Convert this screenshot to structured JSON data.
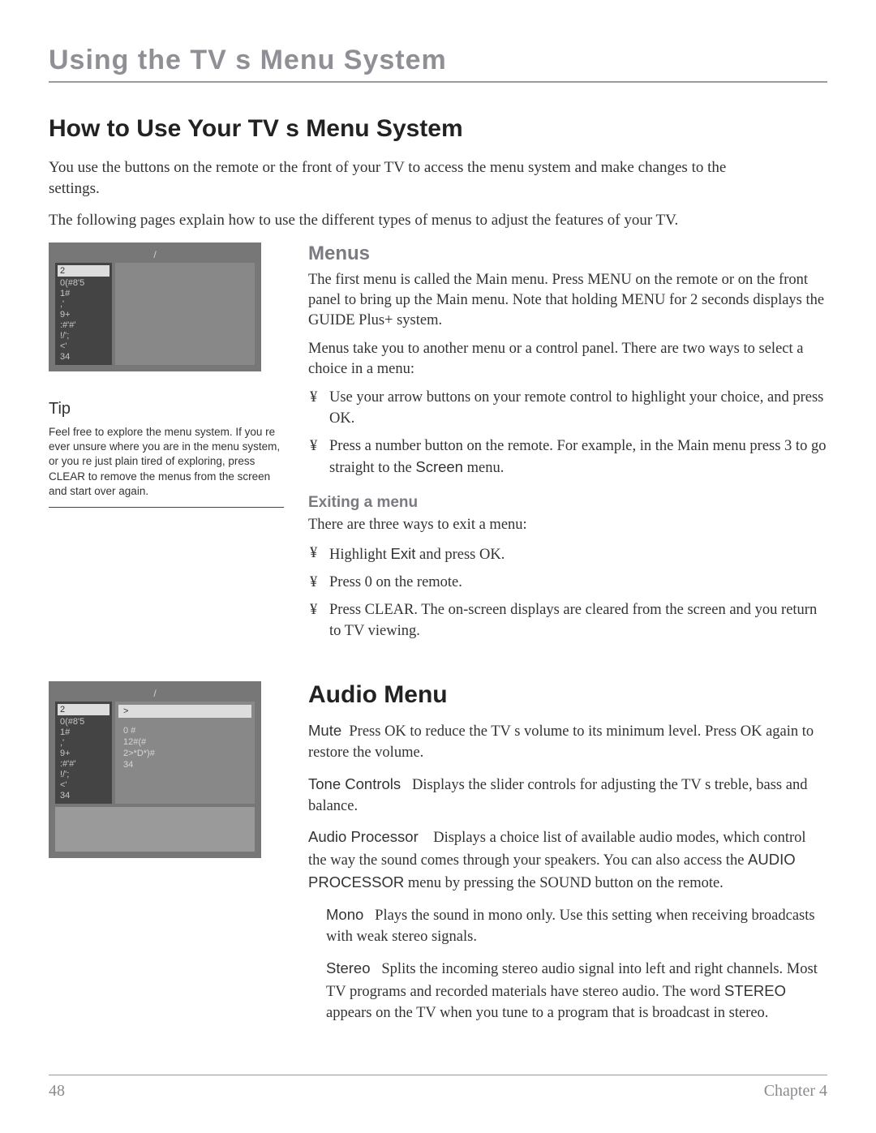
{
  "header": {
    "chapter_title": "Using the TV s Menu System"
  },
  "section1": {
    "title": "How to Use Your TV s Menu System",
    "intro1": "You use the buttons on the remote or the front of your TV to access the menu system and make changes to the settings.",
    "intro2": "The following pages explain how to use the different types of menus to adjust the features of your TV."
  },
  "main_menu_shot": {
    "top": "/",
    "items": [
      "2",
      "0(#8'5",
      "1#",
      ",'",
      "9+",
      ":#'#'",
      "!/';",
      "<'",
      "34"
    ]
  },
  "tip": {
    "heading": "Tip",
    "body": "Feel free to explore the menu system. If you   re ever unsure where you are in the menu system, or you    re just plain tired of exploring, press CLEAR to remove the menus from the screen and start over again."
  },
  "menus": {
    "heading": "Menus",
    "p1": "The first menu is called the Main menu. Press MENU on the remote or on the front panel to bring up the Main menu. Note that holding MENU for 2 seconds displays the GUIDE Plus+ system.",
    "p2": "Menus take you to another menu or a control panel. There are two ways to select a choice in a menu:",
    "bullets": [
      "Use your arrow buttons on your remote control to highlight your choice, and press OK.",
      "Press a number button on the remote. For example, in the Main menu press 3 to go straight to the Screen menu."
    ],
    "exit_heading": "Exiting a menu",
    "exit_lead": "There are three ways to exit a menu:",
    "exit_bullets": [
      "Highlight Exit and press OK.",
      "Press 0 on the remote.",
      "Press CLEAR. The on-screen displays are cleared from the screen and you return to TV viewing."
    ]
  },
  "audio_menu_shot": {
    "top": "/",
    "tabs": [
      "2",
      "0(#8'5",
      "1#",
      ",'",
      "9+",
      ":#'#'",
      "!/';",
      "<'",
      "34"
    ],
    "highlight": ">",
    "items": [
      "0  #",
      "12#(#",
      "2>*D*)#",
      "34"
    ]
  },
  "audio": {
    "title": "Audio Menu",
    "mute_term": "Mute",
    "mute": "Press OK to reduce the TV s volume to its minimum level. Press OK again to restore the volume.",
    "tone_term": "Tone Controls",
    "tone": "Displays the slider controls for adjusting the TV s treble, bass and balance.",
    "proc_term": "Audio Processor",
    "proc": "Displays a choice list of available audio modes, which control the way the sound comes through your speakers. You can also access the AUDIO PROCESSOR menu by pressing the SOUND button on the remote.",
    "mono_term": "Mono",
    "mono": "Plays the sound in mono only. Use this setting when receiving broadcasts with weak stereo signals.",
    "stereo_term": "Stereo",
    "stereo": "Splits the incoming stereo audio signal into left and right channels. Most TV programs and recorded materials have stereo audio. The word STEREO appears on the TV when you tune to a program that is broadcast in stereo."
  },
  "footer": {
    "page": "48",
    "chapter": "Chapter 4"
  }
}
